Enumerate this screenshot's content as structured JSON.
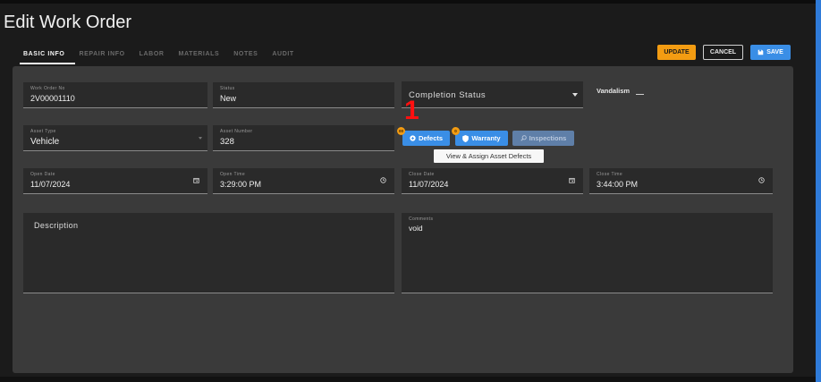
{
  "page": {
    "title": "Edit Work Order"
  },
  "tabs": [
    {
      "label": "BASIC INFO",
      "active": true
    },
    {
      "label": "REPAIR INFO"
    },
    {
      "label": "LABOR"
    },
    {
      "label": "MATERIALS"
    },
    {
      "label": "NOTES"
    },
    {
      "label": "AUDIT"
    }
  ],
  "toolbar": {
    "update_label": "UPDATE",
    "cancel_label": "CANCEL",
    "save_label": "SAVE"
  },
  "fields": {
    "work_order_no": {
      "label": "Work Order No",
      "value": "2V00001110"
    },
    "status": {
      "label": "Status",
      "value": "New"
    },
    "completion_status": {
      "placeholder": "Completion Status"
    },
    "vandalism": {
      "label": "Vandalism"
    },
    "asset_type": {
      "label": "Asset Type",
      "value": "Vehicle"
    },
    "asset_number": {
      "label": "Asset Number",
      "value": "328"
    },
    "open_date": {
      "label": "Open Date",
      "value": "11/07/2024"
    },
    "open_time": {
      "label": "Open Time",
      "value": "3:29:00 PM"
    },
    "close_date": {
      "label": "Close Date",
      "value": "11/07/2024"
    },
    "close_time": {
      "label": "Close Time",
      "value": "3:44:00 PM"
    },
    "description": {
      "placeholder": "Description"
    },
    "comments": {
      "label": "Comments",
      "value": "void"
    }
  },
  "asset_buttons": {
    "defects": {
      "label": "Defects",
      "badge": "00"
    },
    "warranty": {
      "label": "Warranty",
      "badge": "0"
    },
    "inspections": {
      "label": "Inspections"
    }
  },
  "tooltip": {
    "text": "View & Assign Asset Defects"
  },
  "annotation": {
    "marker": "1"
  },
  "colors": {
    "accent_orange": "#f39c12",
    "primary_blue": "#3a8ee6",
    "marker_red": "#ff1010"
  }
}
